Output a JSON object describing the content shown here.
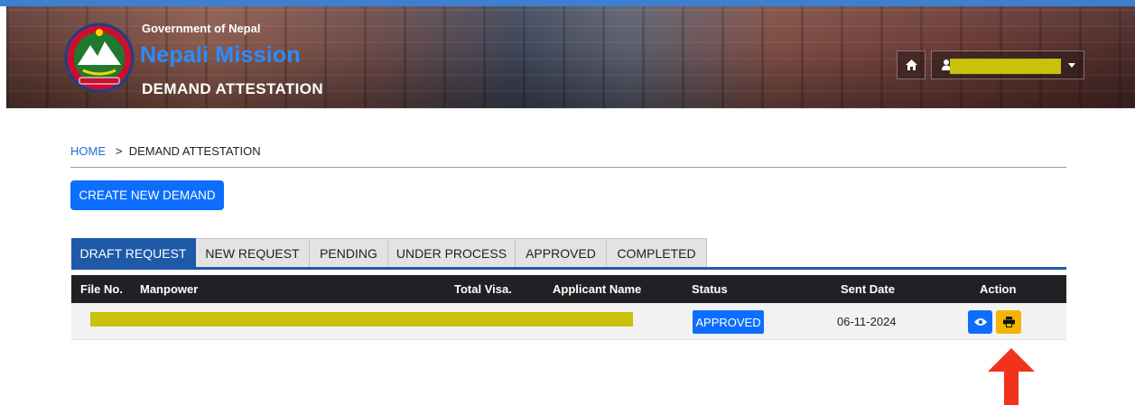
{
  "header": {
    "government_label": "Government of Nepal",
    "mission_title": "Nepali Mission",
    "module_title": "DEMAND ATTESTATION",
    "icons": [
      "emblem-icon",
      "home-icon",
      "user-icon",
      "caret-down-icon"
    ]
  },
  "breadcrumb": {
    "home": "HOME",
    "separator": ">",
    "current": "DEMAND ATTESTATION"
  },
  "actions": {
    "create_label": "CREATE NEW DEMAND"
  },
  "tabs": [
    {
      "label": "DRAFT REQUEST",
      "active": true
    },
    {
      "label": "NEW REQUEST",
      "active": false
    },
    {
      "label": "PENDING",
      "active": false
    },
    {
      "label": "UNDER PROCESS",
      "active": false
    },
    {
      "label": "APPROVED",
      "active": false
    },
    {
      "label": "COMPLETED",
      "active": false
    }
  ],
  "table": {
    "columns": [
      "File No.",
      "Manpower",
      "Total Visa.",
      "Applicant Name",
      "Status",
      "Sent Date",
      "Action"
    ],
    "rows": [
      {
        "status": "APPROVED",
        "sent_date": "06-11-2024",
        "actions": [
          "eye-icon",
          "print-icon"
        ]
      }
    ]
  },
  "colors": {
    "primary": "#0d6efd",
    "tab_active": "#1e5aa8",
    "print_button": "#f5b400",
    "redaction": "#c9c10a",
    "annotation_arrow": "#f0321e",
    "table_header": "#202124"
  }
}
